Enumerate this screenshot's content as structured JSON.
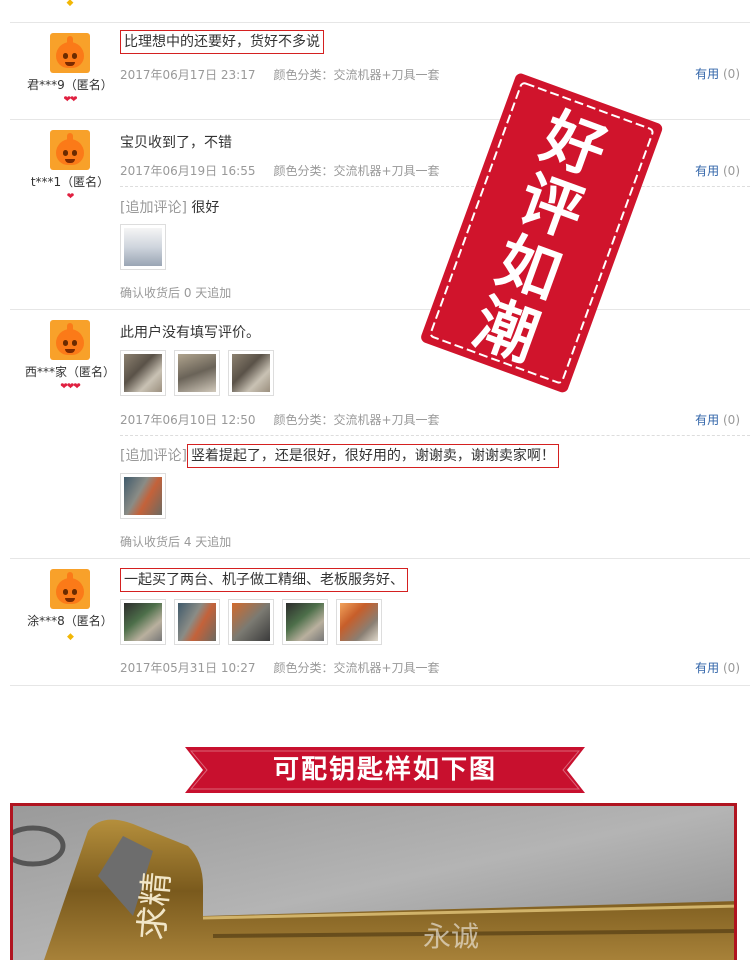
{
  "reviews": [
    {
      "user": "君***9（匿名）",
      "badge": "❤❤",
      "text": "比理想中的还要好，货好不多说",
      "date": "2017年06月17日 23:17",
      "sku": "颜色分类：交流机器+刀具一套",
      "useful_label": "有用",
      "useful_count": "(0)"
    },
    {
      "user": "t***1（匿名）",
      "badge": "❤",
      "text": "宝贝收到了，不错",
      "date": "2017年06月19日 16:55",
      "sku": "颜色分类：交流机器+刀具一套",
      "useful_label": "有用",
      "useful_count": "(0)",
      "append_tag": "[追加评论]",
      "append_text": "很好",
      "confirm": "确认收货后 0 天追加"
    },
    {
      "user": "西***家（匿名）",
      "badge": "❤❤❤",
      "text": "此用户没有填写评价。",
      "date": "2017年06月10日 12:50",
      "sku": "颜色分类：交流机器+刀具一套",
      "useful_label": "有用",
      "useful_count": "(0)",
      "append_tag": "[追加评论]",
      "append_text": "竖着提起了，还是很好，很好用的，谢谢卖，谢谢卖家啊！",
      "confirm": "确认收货后 4 天追加"
    },
    {
      "user": "涂***8（匿名）",
      "badge": "◆",
      "text": "一起买了两台、机子做工精细、老板服务好、",
      "date": "2017年05月31日 10:27",
      "sku": "颜色分类：交流机器+刀具一套",
      "useful_label": "有用",
      "useful_count": "(0)"
    }
  ],
  "stamp_text": [
    "好",
    "评",
    "如",
    "潮"
  ],
  "banner": {
    "text": "可配钥匙样如下图",
    "color": "#c8102e"
  },
  "photo": {
    "key_text": "求精",
    "watermark": "永诚"
  },
  "colors": {
    "link": "#3366aa",
    "highlight_border": "#d42020",
    "muted": "#999999"
  }
}
